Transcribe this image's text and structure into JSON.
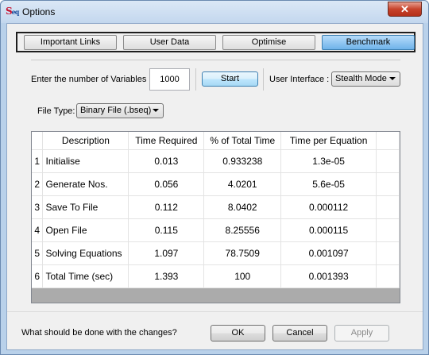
{
  "window": {
    "title": "Options",
    "app_icon_s": "S",
    "app_icon_eq": "eq",
    "close_glyph": "✕"
  },
  "tabs": [
    {
      "label": "Important Links",
      "active": false
    },
    {
      "label": "User Data",
      "active": false
    },
    {
      "label": "Optimise",
      "active": false
    },
    {
      "label": "Benchmark",
      "active": true
    }
  ],
  "benchmark": {
    "variables_label": "Enter the number of Variables :",
    "variables_value": "1000",
    "start_label": "Start",
    "ui_label": "User Interface :",
    "ui_value": "Stealth Mode",
    "filetype_label": "File Type:",
    "filetype_value": "Binary File (.bseq)"
  },
  "table": {
    "columns": [
      "Description",
      "Time Required",
      "% of Total Time",
      "Time per Equation"
    ],
    "rows": [
      {
        "num": "1",
        "cells": [
          "Initialise",
          "0.013",
          "0.933238",
          "1.3e-05"
        ]
      },
      {
        "num": "2",
        "cells": [
          "Generate Nos.",
          "0.056",
          "4.0201",
          "5.6e-05"
        ]
      },
      {
        "num": "3",
        "cells": [
          "Save To File",
          "0.112",
          "8.0402",
          "0.000112"
        ]
      },
      {
        "num": "4",
        "cells": [
          "Open File",
          "0.115",
          "8.25556",
          "0.000115"
        ]
      },
      {
        "num": "5",
        "cells": [
          "Solving Equations",
          "1.097",
          "78.7509",
          "0.001097"
        ]
      },
      {
        "num": "6",
        "cells": [
          "Total Time (sec)",
          "1.393",
          "100",
          "0.001393"
        ]
      }
    ]
  },
  "footer": {
    "question": "What should be done with the changes?",
    "ok": "OK",
    "cancel": "Cancel",
    "apply": "Apply"
  },
  "colors": {
    "accent": "#6fb3ea",
    "title_bar": "#c3d7ee",
    "close_button": "#c7432b"
  }
}
